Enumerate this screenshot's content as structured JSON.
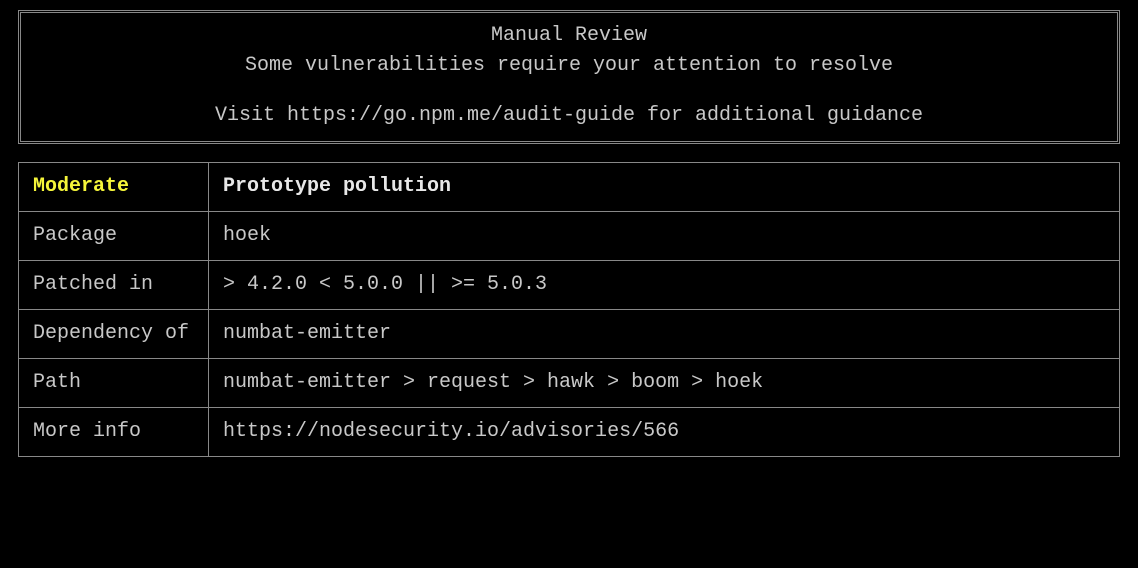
{
  "header": {
    "title": "Manual Review",
    "subtitle": "Some vulnerabilities require your attention to resolve",
    "guide": "Visit https://go.npm.me/audit-guide for additional guidance"
  },
  "vulnerability": {
    "severity": "Moderate",
    "title": "Prototype pollution",
    "rows": [
      {
        "label": "Package",
        "value": "hoek"
      },
      {
        "label": "Patched in",
        "value": "> 4.2.0 < 5.0.0 || >= 5.0.3"
      },
      {
        "label": "Dependency of",
        "value": "numbat-emitter"
      },
      {
        "label": "Path",
        "value": "numbat-emitter > request > hawk > boom > hoek"
      },
      {
        "label": "More info",
        "value": "https://nodesecurity.io/advisories/566"
      }
    ]
  }
}
